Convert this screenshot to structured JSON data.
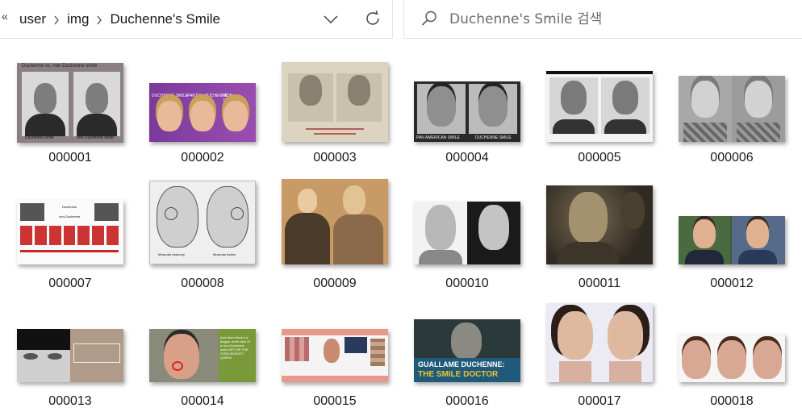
{
  "breadcrumb": {
    "back_glyph": "«",
    "items": [
      "user",
      "img",
      "Duchenne's Smile"
    ]
  },
  "search": {
    "placeholder": "Duchenne's Smile 검색"
  },
  "thumbnail_text": {
    "t1_title": "Duchenne vs. non-Duchenne smile",
    "t1_left": "Duchenne smile",
    "t1_right": "non-Duchenne smile",
    "t2_a": "DUCHENNE SMILE",
    "t2_b": "PARTIAL DUCHENNE",
    "t2_c": "NON-DUCHENNE",
    "t4_left": "PAN AMERICAN SMILE",
    "t4_right": "DUCHENNE SMILE",
    "t7_a": "Duchenne",
    "t7_b": "non-Duchenne",
    "t8_left": "Muscular Anatomy",
    "t8_right": "Muscular Action",
    "t14_caption": "And when there's a bugger at the face of a non-Duchenne smile ART WE THE PURE-BUGGET QUEEN",
    "t16_line1": "GUALLAME DUCHENNE:",
    "t16_line2": "THE SMILE DOCTOR"
  },
  "files": [
    {
      "name": "000001"
    },
    {
      "name": "000002"
    },
    {
      "name": "000003"
    },
    {
      "name": "000004"
    },
    {
      "name": "000005"
    },
    {
      "name": "000006"
    },
    {
      "name": "000007"
    },
    {
      "name": "000008"
    },
    {
      "name": "000009"
    },
    {
      "name": "000010"
    },
    {
      "name": "000011"
    },
    {
      "name": "000012"
    },
    {
      "name": "000013"
    },
    {
      "name": "000014"
    },
    {
      "name": "000015"
    },
    {
      "name": "000016"
    },
    {
      "name": "000017"
    },
    {
      "name": "000018"
    }
  ]
}
